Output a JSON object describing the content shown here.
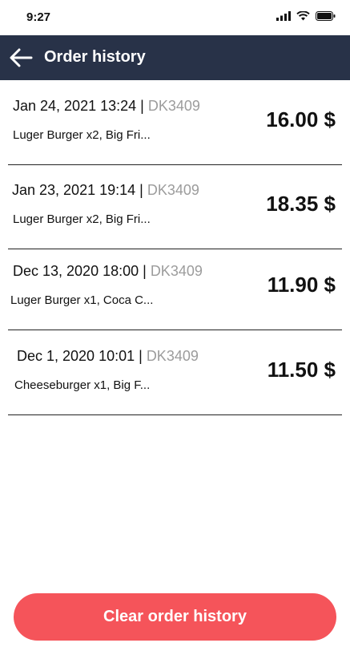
{
  "status_bar": {
    "time": "9:27",
    "icons": [
      "signal-icon",
      "wifi-icon",
      "battery-icon"
    ]
  },
  "header": {
    "back_icon": "arrow-left-icon",
    "title": "Order history"
  },
  "orders": [
    {
      "date": "Jan 24, 2021 13:24",
      "separator": " | ",
      "code": "DK3409",
      "items": "Luger Burger x2, Big Fri...",
      "price": "16.00 $"
    },
    {
      "date": "Jan 23, 2021 19:14",
      "separator": " | ",
      "code": "DK3409",
      "items": "Luger Burger x2, Big Fri...",
      "price": "18.35 $"
    },
    {
      "date": "Dec 13, 2020 18:00",
      "separator": " | ",
      "code": "DK3409",
      "items": "Luger Burger x1, Coca C...",
      "price": "11.90 $"
    },
    {
      "date": "Dec 1, 2020 10:01",
      "separator": " | ",
      "code": "DK3409",
      "items": "Cheeseburger x1, Big F...",
      "price": "11.50 $"
    }
  ],
  "clear_button": {
    "label": "Clear order history"
  },
  "colors": {
    "header_bg": "#283248",
    "button_bg": "#f5545a",
    "code_text": "#9c9c9c"
  }
}
